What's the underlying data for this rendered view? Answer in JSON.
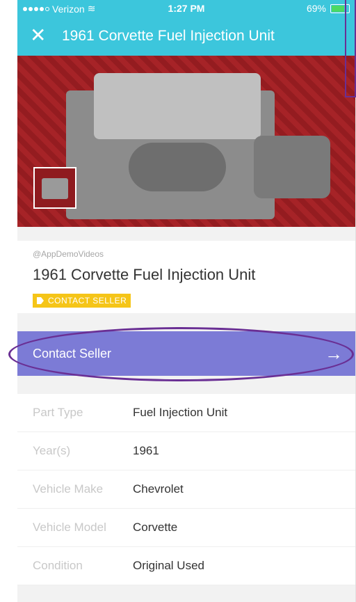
{
  "status_bar": {
    "carrier": "Verizon",
    "time": "1:27 PM",
    "battery": "69%",
    "battery_level": 0.69
  },
  "nav": {
    "title": "1961 Corvette Fuel Injection Unit",
    "close_icon": "close-icon"
  },
  "listing": {
    "owner": "@AppDemoVideos",
    "title": "1961 Corvette Fuel Injection Unit",
    "badge": "CONTACT SELLER",
    "badge_icon": "tag-icon"
  },
  "contact": {
    "label": "Contact Seller",
    "arrow_icon": "arrow-right-icon"
  },
  "details": [
    {
      "label": "Part Type",
      "value": "Fuel Injection Unit"
    },
    {
      "label": "Year(s)",
      "value": "1961"
    },
    {
      "label": "Vehicle Make",
      "value": "Chevrolet"
    },
    {
      "label": "Vehicle Model",
      "value": "Corvette"
    },
    {
      "label": "Condition",
      "value": "Original Used"
    }
  ],
  "colors": {
    "nav": "#3cc6dc",
    "contact": "#7c7bd6",
    "badge": "#f5c518",
    "annotation": "#6a2f94"
  }
}
